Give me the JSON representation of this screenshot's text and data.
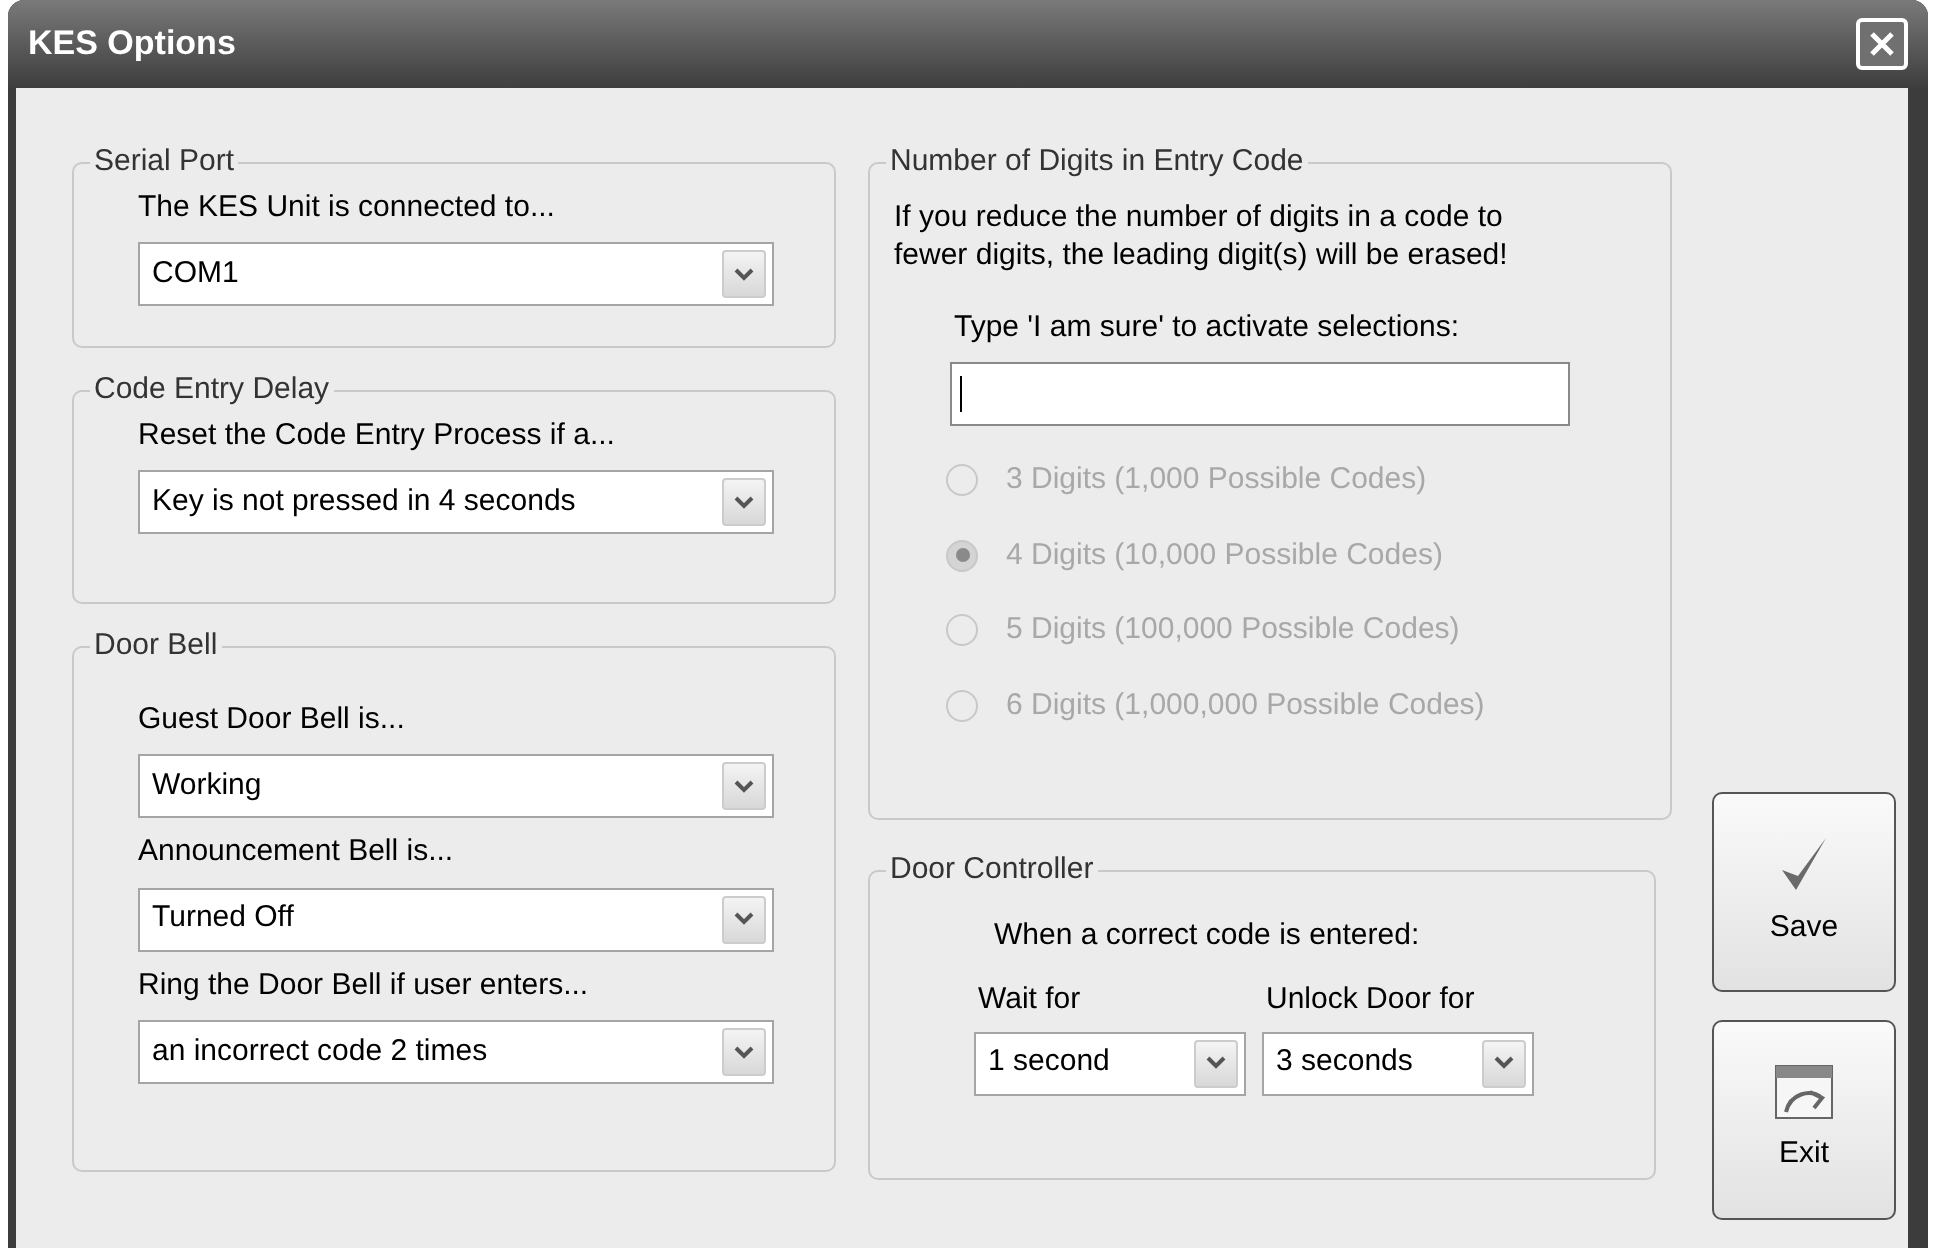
{
  "window": {
    "title": "KES Options"
  },
  "left_groups": [
    {
      "legend": "Serial Port",
      "fields": [
        {
          "label": "The KES Unit is connected to...",
          "value": "COM1"
        }
      ]
    },
    {
      "legend": "Code Entry Delay",
      "fields": [
        {
          "label": "Reset the Code Entry Process if a...",
          "value": "Key is not pressed in 4 seconds"
        }
      ]
    },
    {
      "legend": "Door Bell",
      "fields": [
        {
          "label": "Guest Door Bell is...",
          "value": "Working"
        },
        {
          "label": "Announcement Bell is...",
          "value": "Turned Off"
        },
        {
          "label": "Ring the Door Bell if user enters...",
          "value": "an incorrect code 2 times"
        }
      ]
    }
  ],
  "digits": {
    "legend": "Number of Digits in Entry Code",
    "warning": "If you reduce the number of digits in a code to fewer digits, the leading digit(s) will be erased!",
    "prompt": "Type 'I am sure' to activate selections:",
    "options": [
      {
        "label": "3 Digits (1,000 Possible Codes)",
        "selected": false,
        "disabled": true
      },
      {
        "label": "4 Digits (10,000 Possible Codes)",
        "selected": true,
        "disabled": true
      },
      {
        "label": "5 Digits (100,000 Possible Codes)",
        "selected": false,
        "disabled": true
      },
      {
        "label": "6 Digits (1,000,000 Possible Codes)",
        "selected": false,
        "disabled": true
      }
    ]
  },
  "door_controller": {
    "legend": "Door Controller",
    "instruction": "When a correct code is entered:",
    "fields": [
      {
        "label": "Wait for",
        "value": "1 second"
      },
      {
        "label": "Unlock Door for",
        "value": "3 seconds"
      }
    ]
  },
  "buttons": [
    {
      "label": "Save",
      "kind": "save"
    },
    {
      "label": "Exit",
      "kind": "exit"
    }
  ]
}
